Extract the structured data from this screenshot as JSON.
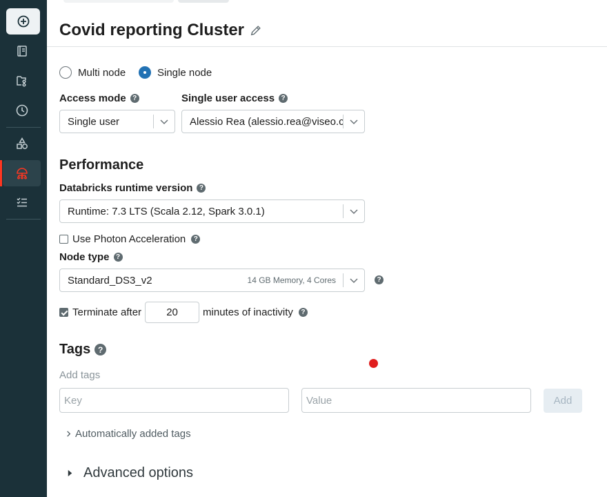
{
  "sidebar": {
    "items": [
      {
        "name": "create",
        "icon": "plus-circle-icon"
      },
      {
        "name": "notebook",
        "icon": "notebook-icon"
      },
      {
        "name": "workspace",
        "icon": "folder-tree-icon"
      },
      {
        "name": "recents",
        "icon": "clock-icon"
      },
      {
        "name": "catalog",
        "icon": "shapes-icon"
      },
      {
        "name": "compute",
        "icon": "cluster-icon"
      },
      {
        "name": "workflows",
        "icon": "checklist-icon"
      }
    ],
    "accent": "#ff3621"
  },
  "page": {
    "title": "Covid reporting Cluster"
  },
  "node_mode": {
    "options": [
      "Multi node",
      "Single node"
    ],
    "selected": "Single node"
  },
  "access_mode": {
    "label": "Access mode",
    "value": "Single user"
  },
  "single_user_access": {
    "label": "Single user access",
    "value": "Alessio Rea (alessio.rea@viseo.co..."
  },
  "performance": {
    "heading": "Performance",
    "runtime_label": "Databricks runtime version",
    "runtime_value": "Runtime: 7.3 LTS (Scala 2.12, Spark 3.0.1)",
    "photon_label": "Use Photon Acceleration",
    "photon_checked": false,
    "node_type_label": "Node type",
    "node_type_value": "Standard_DS3_v2",
    "node_type_detail": "14 GB Memory, 4 Cores",
    "terminate_label": "Terminate after",
    "terminate_checked": true,
    "terminate_minutes": "20",
    "terminate_suffix": "minutes of inactivity"
  },
  "tags": {
    "heading": "Tags",
    "add_tags": "Add tags",
    "key_placeholder": "Key",
    "value_placeholder": "Value",
    "add_label": "Add",
    "auto_tags_label": "Automatically added tags"
  },
  "advanced": {
    "label": "Advanced options"
  }
}
